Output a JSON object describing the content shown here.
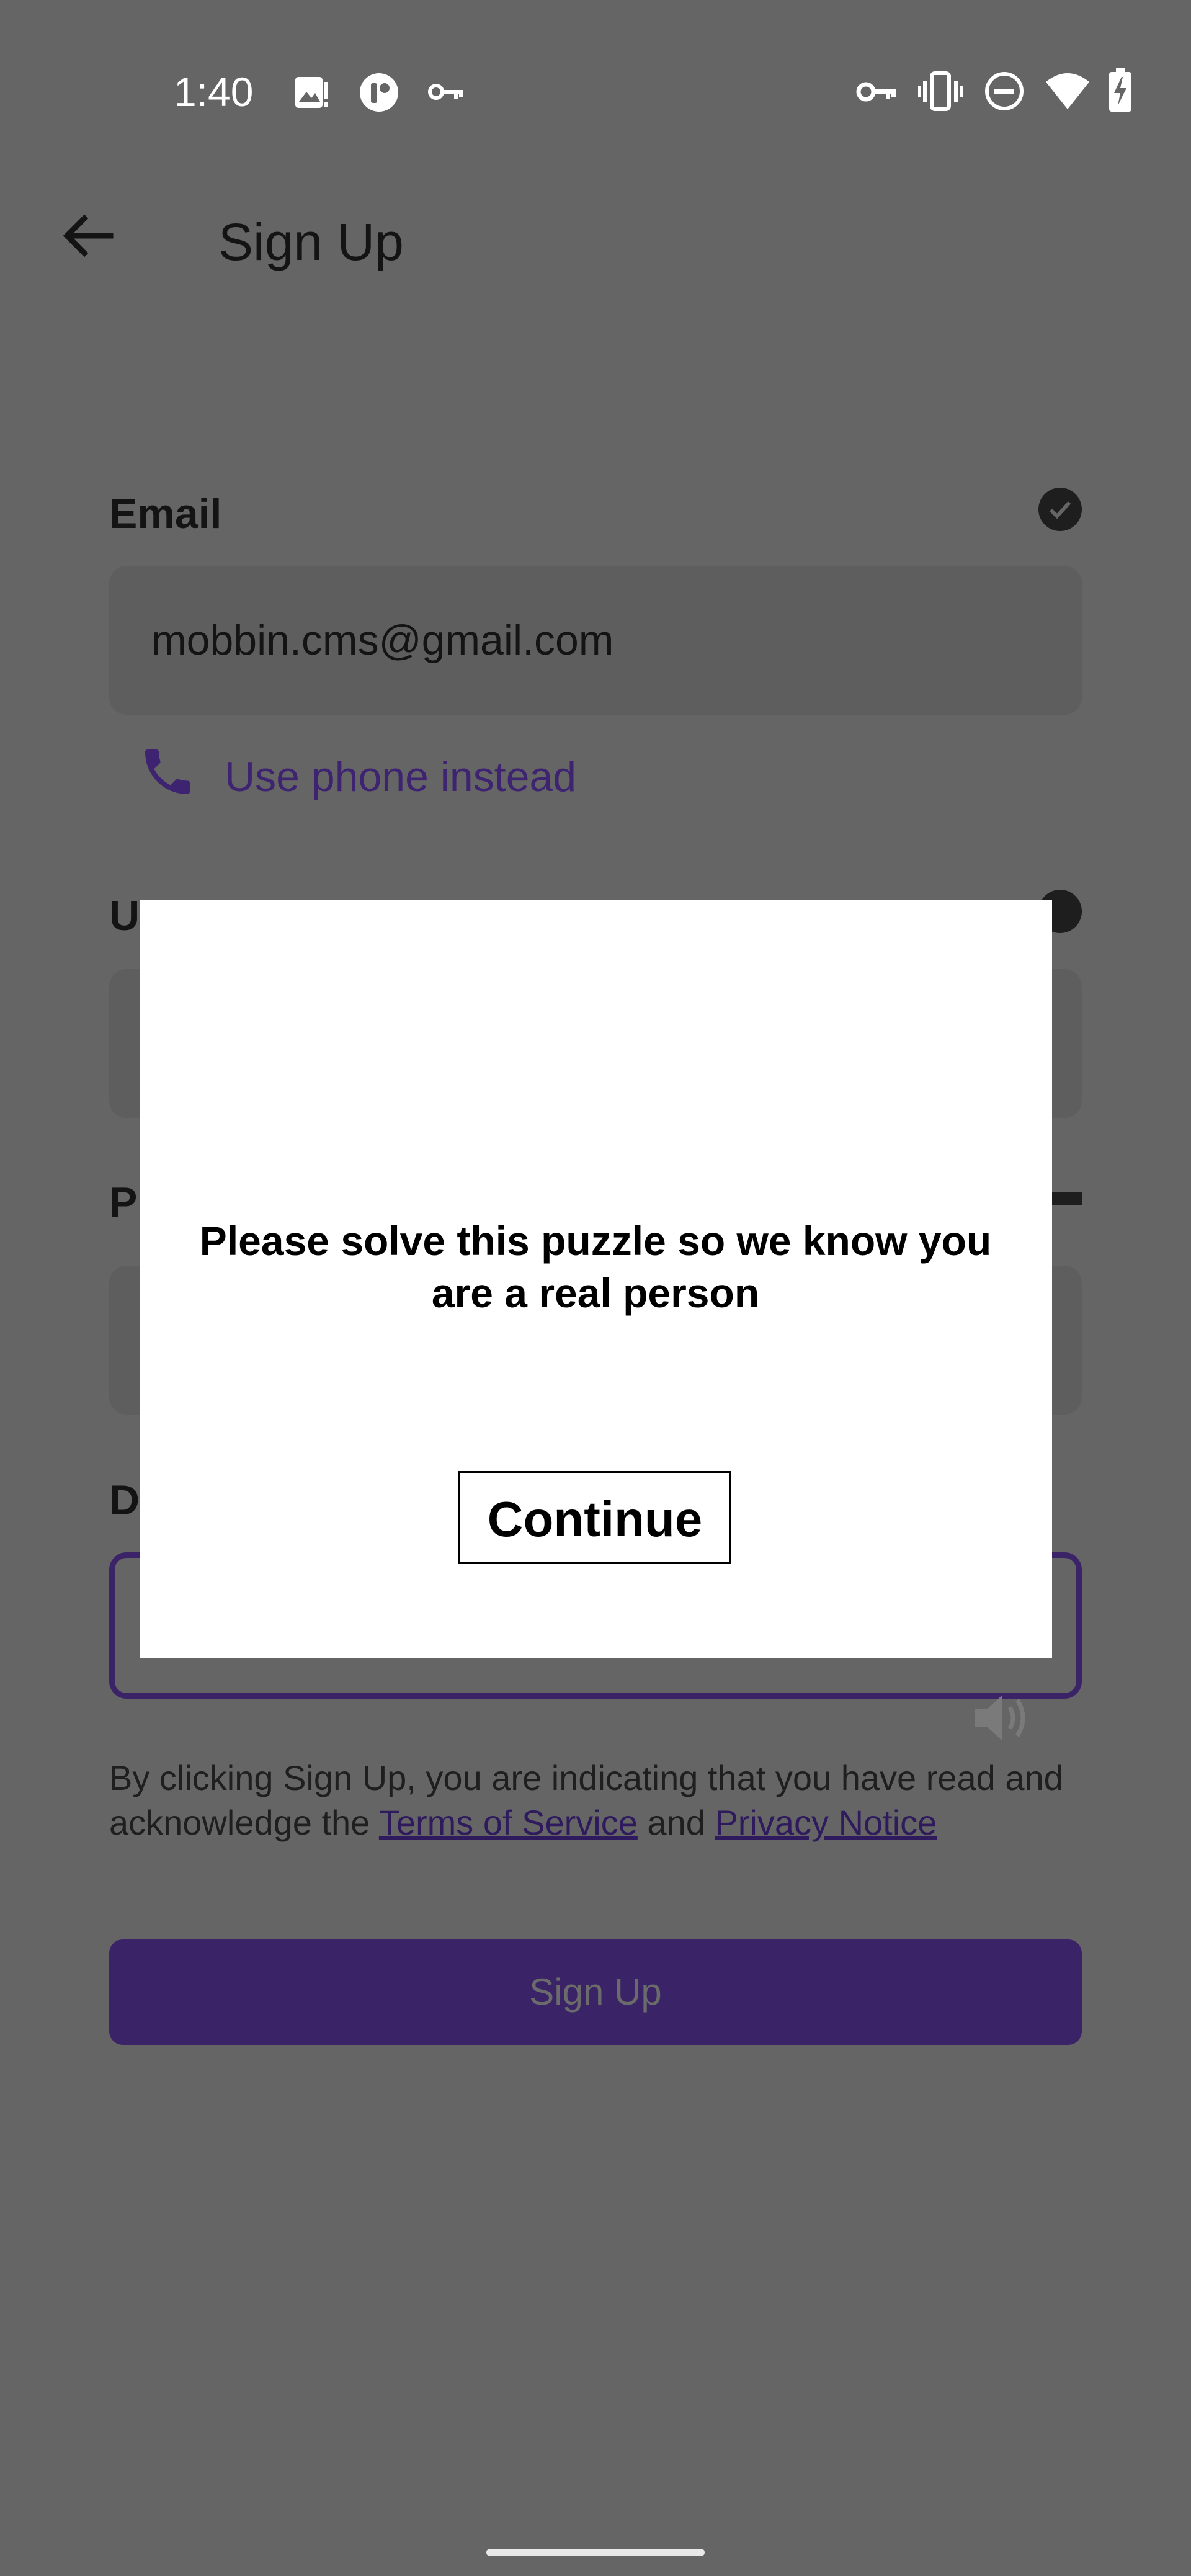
{
  "status_bar": {
    "time": "1:40",
    "left_icons": [
      "image-alert-icon",
      "app-badge-icon",
      "key-icon"
    ],
    "right_icons": [
      "vpn-key-icon",
      "vibrate-icon",
      "do-not-disturb-icon",
      "wifi-icon",
      "battery-charging-icon"
    ]
  },
  "header": {
    "back_icon": "arrow-left-icon",
    "title": "Sign Up"
  },
  "form": {
    "email_label": "Email",
    "email_value": "mobbin.cms@gmail.com",
    "use_phone_label": "Use phone instead",
    "username_label_partial": "U",
    "password_label_partial": "P",
    "dob_label_partial": "D"
  },
  "terms": {
    "prefix": "By clicking Sign Up, you are indicating that you have read and acknowledge the ",
    "tos_link": "Terms of Service",
    "middle": " and ",
    "privacy_link": "Privacy Notice"
  },
  "signup_button": "Sign Up",
  "modal": {
    "message": "Please solve this puzzle so we know you are a real person",
    "continue_label": "Continue"
  },
  "colors": {
    "overlay_background": "#656565",
    "accent_purple": "#3b2368",
    "modal_background": "#ffffff"
  }
}
